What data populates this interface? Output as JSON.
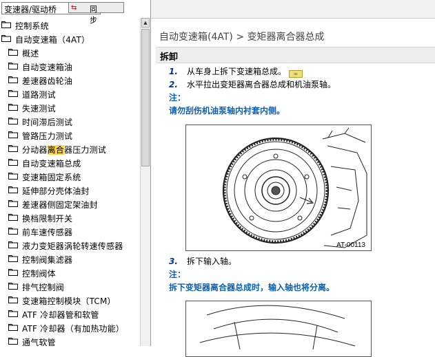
{
  "combo": {
    "value": "变速器/驱动桥"
  },
  "sync_button": {
    "label": "同 步",
    "icon": "link-icon"
  },
  "tree": [
    {
      "label": "控制系统",
      "level": 0
    },
    {
      "label": "自动变速箱（4AT）",
      "level": 0
    },
    {
      "label": "概述",
      "level": 1
    },
    {
      "label": "自动变速箱油",
      "level": 1
    },
    {
      "label": "差速器齿轮油",
      "level": 1
    },
    {
      "label": "道路测试",
      "level": 1
    },
    {
      "label": "失速测试",
      "level": 1
    },
    {
      "label": "时间滞后测试",
      "level": 1
    },
    {
      "label": "管路压力测试",
      "level": 1
    },
    {
      "label": "分动器离合器压力测试",
      "level": 1,
      "highlight": "离合"
    },
    {
      "label": "自动变速箱总成",
      "level": 1
    },
    {
      "label": "变速箱固定系统",
      "level": 1
    },
    {
      "label": "延伸部分壳体油封",
      "level": 1
    },
    {
      "label": "差速器侧固定架油封",
      "level": 1
    },
    {
      "label": "换档限制开关",
      "level": 1
    },
    {
      "label": "前车速传感器",
      "level": 1
    },
    {
      "label": "液力变矩器涡轮转速传感器",
      "level": 1
    },
    {
      "label": "控制阀集滤器",
      "level": 1
    },
    {
      "label": "控制阀体",
      "level": 1
    },
    {
      "label": "排气控制阀",
      "level": 1
    },
    {
      "label": "变速箱控制模块（TCM）",
      "level": 1
    },
    {
      "label": "ATF 冷却器管和软管",
      "level": 1
    },
    {
      "label": "ATF 冷却器（有加热功能）",
      "level": 1
    },
    {
      "label": "通气软管",
      "level": 1
    }
  ],
  "content": {
    "breadcrumb": "自动变速箱(4AT) > 变矩器离合器总成",
    "section_title": "拆卸",
    "steps": [
      {
        "num": "1.",
        "text": "从车身上拆下变速箱总成。"
      },
      {
        "num": "2.",
        "text": "水平拉出变矩器离合器总成和机油泵轴。"
      },
      {
        "num": "3.",
        "text": "拆下输入轴。"
      }
    ],
    "notes": [
      {
        "label": "注：",
        "text": "请勿刮伤机油泵轴内衬套内侧。"
      },
      {
        "label": "注：",
        "text": "拆下变矩器离合器总成时，输入轴也将分离。"
      }
    ],
    "figure_caption": "AT-00113"
  },
  "colors": {
    "note": "#0a5fb0",
    "step_number": "#003399",
    "highlight": "#ffd54a",
    "section_bar": "#eeeeee"
  }
}
